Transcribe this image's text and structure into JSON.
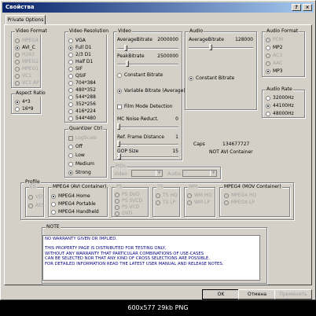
{
  "window": {
    "title": "Свойства",
    "help_label": "?",
    "close_label": "×"
  },
  "tab": "Private Options",
  "video_format": {
    "legend": "Video Format",
    "options": [
      "MPEG4",
      "AVI_C",
      "H263",
      "MPEG2",
      "MPEG1",
      "VC1",
      "VC1 AP"
    ],
    "selected": "AVI_C"
  },
  "aspect_ratio": {
    "legend": "Aspect Ratio",
    "options": [
      "4*3",
      "16*9"
    ],
    "selected": "4*3"
  },
  "video_resolution": {
    "legend": "Video Resolution",
    "options": [
      "VGA",
      "Full D1",
      "2/3 D1",
      "Half D1",
      "SIF",
      "QSIF",
      "704*384",
      "480*352",
      "544*288",
      "352*256",
      "416*224",
      "544*480"
    ],
    "selected": "Full D1"
  },
  "quantizer": {
    "legend": "Quantizer Ctrl",
    "logscale_label": "LogScale",
    "options": [
      "Off",
      "Low",
      "Medium",
      "Strong"
    ],
    "selected": "Strong"
  },
  "video": {
    "legend": "Video",
    "average_bitrate_label": "AverageBitrate",
    "average_bitrate_value": "2000000",
    "peak_bitrate_label": "PeakBitrate",
    "peak_bitrate_value": "2500000",
    "constant_bitrate_label": "Constant Bitrate",
    "variable_bitrate_label": "Variable Bitrate (Average)",
    "film_mode_label": "Film Mode Detection",
    "mc_noise_label": "MC Noise Reduct.",
    "mc_noise_value": "0",
    "ref_frame_label": "Ref. Frame Distance",
    "ref_frame_value": "1",
    "gop_size_label": "GOP Size",
    "gop_size_value": "15"
  },
  "audio": {
    "legend": "Audio",
    "average_bitrate_label": "AverageBitrate",
    "average_bitrate_value": "128000",
    "constant_bitrate_label": "Constant Bitrate",
    "caps_label": "Caps",
    "caps_value": "134677727",
    "container_note": "NOT AVI Container"
  },
  "audio_format": {
    "legend": "Audio Format",
    "options": [
      "PCM",
      "MP2",
      "AC3",
      "AAC",
      "MP3"
    ],
    "selected": "MP3"
  },
  "audio_rate": {
    "legend": "Audio Rate",
    "options": [
      "32000Hz",
      "44100Hz",
      "48000Hz"
    ],
    "selected": "44100Hz"
  },
  "pids": {
    "legend": "PIDs",
    "video_label": "Video",
    "audio_label": "Audio"
  },
  "profile": {
    "legend": "Profile",
    "es": {
      "legend": "ES",
      "options": [
        "VES",
        "AES"
      ]
    },
    "mpeg4_avi": {
      "legend": "MPEG4 (AVI Container)",
      "options": [
        "MPEG4 Home",
        "MPEG4 Portable",
        "MPEG4 Handheld"
      ],
      "selected": "MPEG4 Home"
    },
    "ps": {
      "legend": "PS",
      "options": [
        "PS DVD",
        "PS SVCD",
        "PS VCD",
        "DVD"
      ]
    },
    "ts": {
      "legend": "TS",
      "options": [
        "TS HQ",
        "TS LP"
      ]
    },
    "wm": {
      "legend": "WM",
      "options": [
        "WM HQ",
        "WM LP"
      ]
    },
    "mpeg4_mov": {
      "legend": "MPEG4 (MOV Container)",
      "options": [
        "MPEG4 HQ",
        "MPEG4 LP"
      ]
    }
  },
  "note": {
    "legend": "NOTE",
    "lines": [
      "NO WARRANTY GIVEN OR IMPLIED.",
      "",
      "THIS PROPERTY PAGE IS DISTRIBUTED FOR TESTING ONLY,",
      "WITHOUT ANY WARRANTY THAT PARTICULAR COMBINATIONS OF USE-CASES",
      "CAN BE SELECTED NOR THAT ANY KIND OF CROSS SELECTIONS ARE POSSIBLE.",
      "FOR DETAILED INFORMATION READ THE LATEST USER MANUAL AND RELEASE NOTES."
    ]
  },
  "buttons": {
    "ok": "OK",
    "cancel": "Отмена",
    "apply": "Применить"
  },
  "caption": "600x577  29kb  PNG"
}
